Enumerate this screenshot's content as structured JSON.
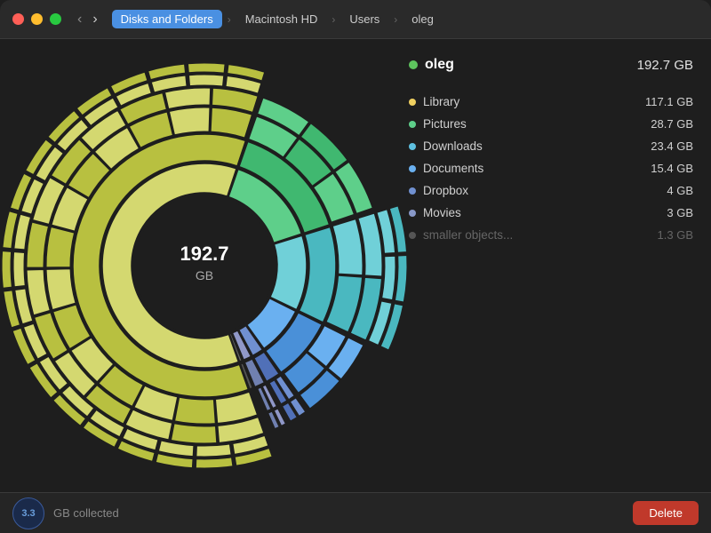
{
  "titlebar": {
    "back_label": "‹",
    "forward_label": "›",
    "breadcrumb": [
      {
        "label": "Disks and Folders",
        "active": true
      },
      {
        "label": "Macintosh HD",
        "active": false
      },
      {
        "label": "Users",
        "active": false
      },
      {
        "label": "oleg",
        "active": false
      }
    ]
  },
  "chart": {
    "center_label": "192.7",
    "center_sublabel": "GB"
  },
  "legend": {
    "title": {
      "name": "oleg",
      "size": "192.7 GB",
      "dot_color": "#5ec45e"
    },
    "items": [
      {
        "name": "Library",
        "size": "117.1 GB",
        "color": "#f0d060",
        "dimmed": false
      },
      {
        "name": "Pictures",
        "size": "28.7 GB",
        "color": "#5ecf8a",
        "dimmed": false
      },
      {
        "name": "Downloads",
        "size": "23.4 GB",
        "color": "#5ec0e0",
        "dimmed": false
      },
      {
        "name": "Documents",
        "size": "15.4 GB",
        "color": "#6ab0f0",
        "dimmed": false
      },
      {
        "name": "Dropbox",
        "size": "4 GB",
        "color": "#7090d0",
        "dimmed": false
      },
      {
        "name": "Movies",
        "size": "3 GB",
        "color": "#8898c8",
        "dimmed": false
      },
      {
        "name": "smaller objects...",
        "size": "1.3 GB",
        "color": "#555",
        "dimmed": true
      }
    ]
  },
  "bottom_bar": {
    "collected_value": "3.3",
    "collected_label": "GB collected",
    "delete_label": "Delete"
  }
}
